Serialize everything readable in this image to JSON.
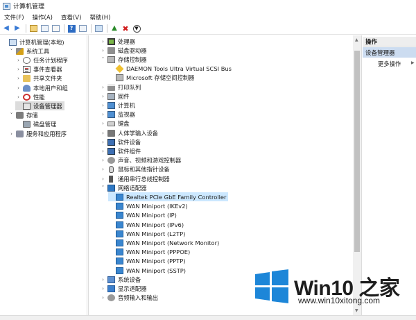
{
  "window": {
    "title": "计算机管理"
  },
  "menu": [
    "文件(F)",
    "操作(A)",
    "查看(V)",
    "帮助(H)"
  ],
  "left_tree": [
    {
      "label": "计算机管理(本地)",
      "icon": "computer-icon",
      "expander": "",
      "indent": 0
    },
    {
      "label": "系统工具",
      "icon": "tools-icon",
      "expander": "v",
      "indent": 1
    },
    {
      "label": "任务计划程序",
      "icon": "clock-icon",
      "expander": ">",
      "indent": 2
    },
    {
      "label": "事件查看器",
      "icon": "event-icon",
      "expander": ">",
      "indent": 2
    },
    {
      "label": "共享文件夹",
      "icon": "folder-icon",
      "expander": ">",
      "indent": 2
    },
    {
      "label": "本地用户和组",
      "icon": "users-icon",
      "expander": ">",
      "indent": 2
    },
    {
      "label": "性能",
      "icon": "performance-icon",
      "expander": ">",
      "indent": 2
    },
    {
      "label": "设备管理器",
      "icon": "device-manager-icon",
      "expander": "",
      "indent": 2,
      "selected": true
    },
    {
      "label": "存储",
      "icon": "storage-icon",
      "expander": "v",
      "indent": 1
    },
    {
      "label": "磁盘管理",
      "icon": "disk-icon",
      "expander": "",
      "indent": 2
    },
    {
      "label": "服务和应用程序",
      "icon": "services-icon",
      "expander": ">",
      "indent": 1
    }
  ],
  "device_tree": [
    {
      "label": "处理器",
      "icon": "chip-icon",
      "expander": ">",
      "indent": 0
    },
    {
      "label": "磁盘驱动器",
      "icon": "drive-icon",
      "expander": ">",
      "indent": 0
    },
    {
      "label": "存储控制器",
      "icon": "controller-icon",
      "expander": "v",
      "indent": 0
    },
    {
      "label": "DAEMON Tools Ultra Virtual SCSI Bus",
      "icon": "daemon-icon",
      "expander": "",
      "indent": 1
    },
    {
      "label": "Microsoft 存储空间控制器",
      "icon": "controller-icon",
      "expander": "",
      "indent": 1
    },
    {
      "label": "打印队列",
      "icon": "printer-icon",
      "expander": ">",
      "indent": 0
    },
    {
      "label": "固件",
      "icon": "firmware-icon",
      "expander": ">",
      "indent": 0
    },
    {
      "label": "计算机",
      "icon": "monitor-icon",
      "expander": ">",
      "indent": 0
    },
    {
      "label": "监视器",
      "icon": "monitor-icon",
      "expander": ">",
      "indent": 0
    },
    {
      "label": "键盘",
      "icon": "keyboard-icon",
      "expander": ">",
      "indent": 0
    },
    {
      "label": "人体学输入设备",
      "icon": "hid-icon",
      "expander": ">",
      "indent": 0
    },
    {
      "label": "软件设备",
      "icon": "software-device-icon",
      "expander": ">",
      "indent": 0
    },
    {
      "label": "软件组件",
      "icon": "software-device-icon",
      "expander": ">",
      "indent": 0
    },
    {
      "label": "声音、视频和游戏控制器",
      "icon": "sound-icon",
      "expander": ">",
      "indent": 0
    },
    {
      "label": "鼠标和其他指针设备",
      "icon": "mouse-icon",
      "expander": ">",
      "indent": 0
    },
    {
      "label": "通用串行总线控制器",
      "icon": "usb-icon",
      "expander": ">",
      "indent": 0
    },
    {
      "label": "网络适配器",
      "icon": "network-icon",
      "expander": "v",
      "indent": 0
    },
    {
      "label": "Realtek PCIe GbE Family Controller",
      "icon": "network-card-icon",
      "expander": "",
      "indent": 1,
      "selected": true
    },
    {
      "label": "WAN Miniport (IKEv2)",
      "icon": "network-card-icon",
      "expander": "",
      "indent": 1
    },
    {
      "label": "WAN Miniport (IP)",
      "icon": "network-card-icon",
      "expander": "",
      "indent": 1
    },
    {
      "label": "WAN Miniport (IPv6)",
      "icon": "network-card-icon",
      "expander": "",
      "indent": 1
    },
    {
      "label": "WAN Miniport (L2TP)",
      "icon": "network-card-icon",
      "expander": "",
      "indent": 1
    },
    {
      "label": "WAN Miniport (Network Monitor)",
      "icon": "network-card-icon",
      "expander": "",
      "indent": 1
    },
    {
      "label": "WAN Miniport (PPPOE)",
      "icon": "network-card-icon",
      "expander": "",
      "indent": 1
    },
    {
      "label": "WAN Miniport (PPTP)",
      "icon": "network-card-icon",
      "expander": "",
      "indent": 1
    },
    {
      "label": "WAN Miniport (SSTP)",
      "icon": "network-card-icon",
      "expander": "",
      "indent": 1
    },
    {
      "label": "系统设备",
      "icon": "system-device-icon",
      "expander": ">",
      "indent": 0
    },
    {
      "label": "显示适配器",
      "icon": "display-adapter-icon",
      "expander": ">",
      "indent": 0
    },
    {
      "label": "音频输入和输出",
      "icon": "audio-icon",
      "expander": ">",
      "indent": 0
    }
  ],
  "actions": {
    "header": "操作",
    "section": "设备管理器",
    "more": "更多操作"
  },
  "watermark": {
    "brand": "Win10 之家",
    "url": "www.win10xitong.com",
    "logo_color": "#1d86d8"
  }
}
